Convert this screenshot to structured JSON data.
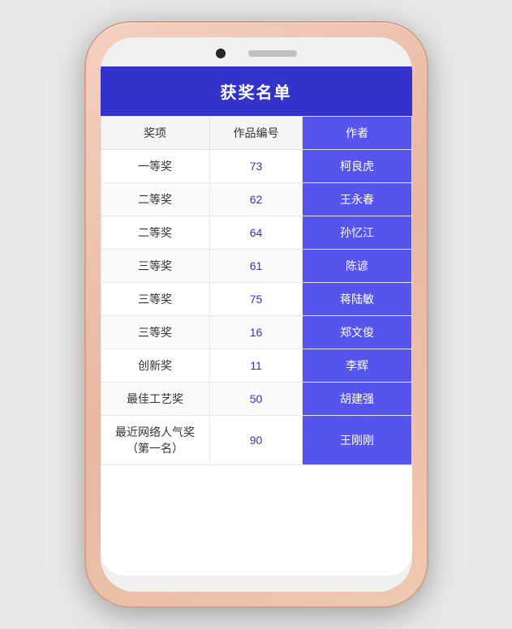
{
  "page": {
    "title": "获奖名单",
    "columns": {
      "prize": "奖项",
      "work_id": "作品编号",
      "author": "作者"
    },
    "rows": [
      {
        "prize": "一等奖",
        "work_id": "73",
        "author": "柯良虎"
      },
      {
        "prize": "二等奖",
        "work_id": "62",
        "author": "王永春"
      },
      {
        "prize": "二等奖",
        "work_id": "64",
        "author": "孙忆江"
      },
      {
        "prize": "三等奖",
        "work_id": "61",
        "author": "陈谚"
      },
      {
        "prize": "三等奖",
        "work_id": "75",
        "author": "蒋陆敏"
      },
      {
        "prize": "三等奖",
        "work_id": "16",
        "author": "郑文俊"
      },
      {
        "prize": "创新奖",
        "work_id": "11",
        "author": "李辉"
      },
      {
        "prize": "最佳工艺奖",
        "work_id": "50",
        "author": "胡建强"
      },
      {
        "prize": "最近网络人气奖（第一名）",
        "work_id": "90",
        "author": "王刚刚"
      }
    ]
  }
}
